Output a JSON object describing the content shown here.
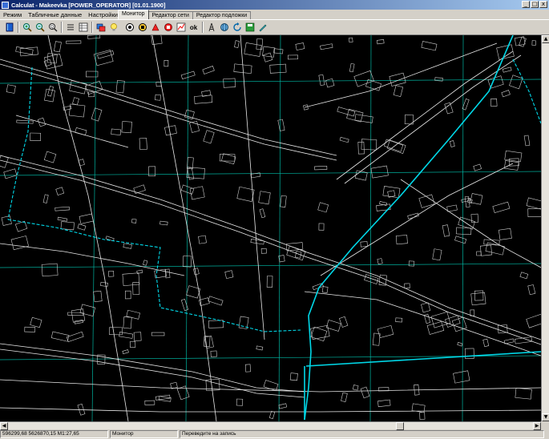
{
  "window": {
    "title": "Calculat - Makeevka [POWER_OPERATOR] [01.01.1900]",
    "controls": [
      "_",
      "□",
      "x"
    ]
  },
  "menu": {
    "items": [
      "Режим",
      "Табличные данные",
      "Настройки"
    ]
  },
  "tabs": [
    {
      "label": "Монитор",
      "active": true
    },
    {
      "label": "Редактор сети",
      "active": false
    },
    {
      "label": "Редактор подложки",
      "active": false
    }
  ],
  "toolbar": {
    "left_icons": [
      "book-icon",
      "zoom-in-icon",
      "zoom-out-icon",
      "zoom-fit-icon",
      "list-icon",
      "grid-icon",
      "layers-icon",
      "bulb-icon"
    ],
    "right_icons": [
      "alarm-icon",
      "device-icon",
      "run-icon",
      "stop-icon",
      "chart-icon",
      "ok-icon",
      "tower-icon",
      "globe-icon",
      "refresh-icon",
      "save-icon",
      "pen-icon"
    ],
    "ok_label": "ok"
  },
  "map": {
    "background": "#000000",
    "street_color": "#ffffff",
    "grid_color": "#00b3a0",
    "power_line_color": "#00d8e8"
  },
  "status": {
    "coords": "596299,68 5626870,15 M1:27,65",
    "mode": "Монитор",
    "message": "Переведите на запись"
  }
}
